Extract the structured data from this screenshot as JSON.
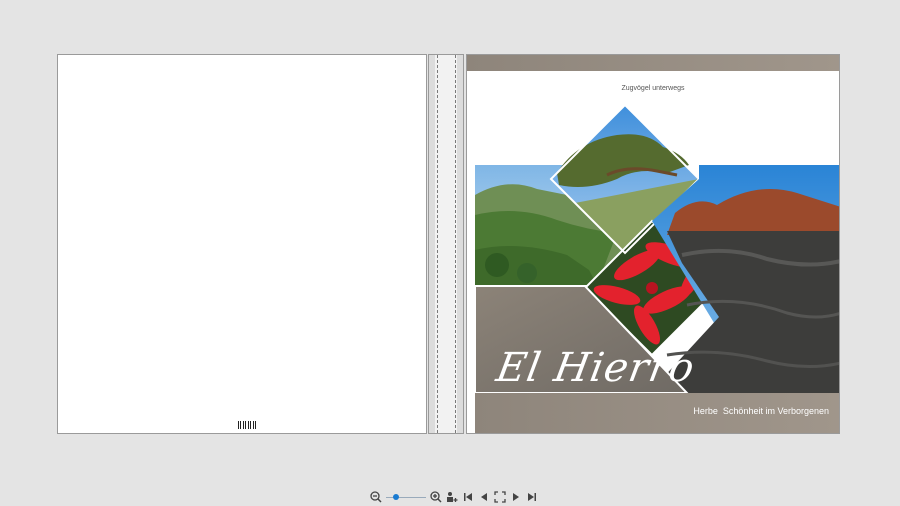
{
  "cover": {
    "kicker": "Zugvögel unterwegs",
    "title": "El Hierro",
    "subtitle": "Herbe  Schönheit im Verborgenen"
  },
  "colors": {
    "band": "#9b9185",
    "photo_frame": "#ffffff",
    "page_bg": "#e4e4e4"
  },
  "toolbar": {
    "zoom_level_percent": 20,
    "icons": [
      "zoom-out-icon",
      "zoom-slider",
      "zoom-in-icon",
      "add-page-icon",
      "first-page-icon",
      "prev-page-icon",
      "fit-screen-icon",
      "next-page-icon",
      "last-page-icon"
    ]
  }
}
